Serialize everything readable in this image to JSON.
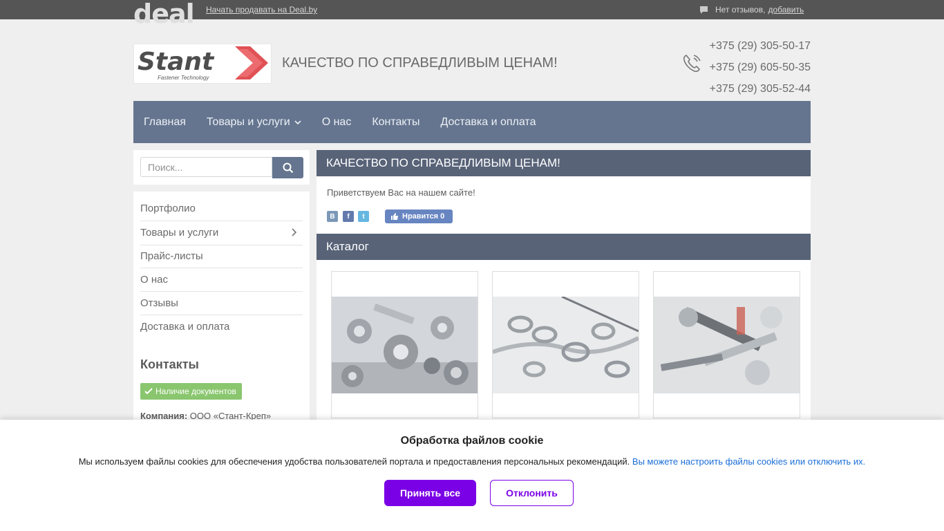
{
  "topbar": {
    "logo_text": "deal",
    "sell_link": "Начать продавать на Deal.by",
    "reviews_text": "Нет отзывов,",
    "reviews_add": "добавить"
  },
  "header": {
    "logo_brand": "Stant",
    "logo_tagline": "Fastener Technology",
    "slogan": "КАЧЕСТВО ПО СПРАВЕДЛИВЫМ ЦЕНАМ!",
    "phones": [
      "+375 (29) 305-50-17",
      "+375 (29) 605-50-35",
      "+375 (29) 305-52-44"
    ]
  },
  "nav": {
    "items": [
      "Главная",
      "Товары и услуги",
      "О нас",
      "Контакты",
      "Доставка и оплата"
    ]
  },
  "sidebar": {
    "search_placeholder": "Поиск...",
    "menu": [
      "Портфолио",
      "Товары и услуги",
      "Прайс-листы",
      "О нас",
      "Отзывы",
      "Доставка и оплата"
    ],
    "contacts_title": "Контакты",
    "docs_badge": "Наличие документов",
    "company_label": "Компания:",
    "company_value": "ООО «Стант-Креп»"
  },
  "main": {
    "title": "КАЧЕСТВО ПО СПРАВЕДЛИВЫМ ЦЕНАМ!",
    "welcome": "Приветствуем Вас на нашем сайте!",
    "share": [
      "В",
      "f",
      "t"
    ],
    "like_label": "Нравится",
    "like_count": "0",
    "catalog_title": "Каталог"
  },
  "cookie": {
    "title": "Обработка файлов cookie",
    "text": "Мы используем файлы cookies для обеспечения удобства пользователей портала и предоставления персональных рекомендаций.",
    "link": "Вы можете настроить файлы cookies или отключить их.",
    "accept": "Принять все",
    "decline": "Отклонить"
  },
  "colors": {
    "nav_bg": "#3f5373",
    "header_bar": "#2f3d57",
    "accent_purple": "#7a00e6",
    "badge_green": "#6cb84a"
  }
}
